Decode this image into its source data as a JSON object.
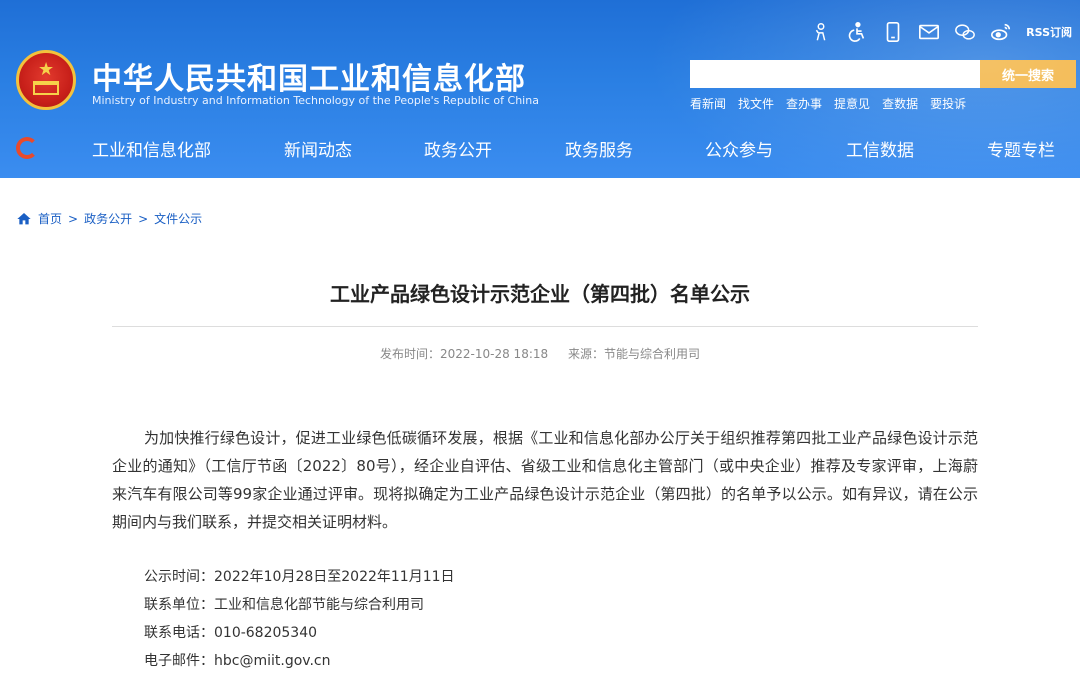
{
  "header": {
    "title": "中华人民共和国工业和信息化部",
    "subtitle": "Ministry of Industry and Information Technology of the People's Republic of China",
    "rss_label": "RSS订阅",
    "search_placeholder": "",
    "search_button": "统一搜索",
    "quick_links": [
      "看新闻",
      "找文件",
      "查办事",
      "提意见",
      "查数据",
      "要投诉"
    ],
    "nav": [
      "工业和信息化部",
      "新闻动态",
      "政务公开",
      "政务服务",
      "公众参与",
      "工信数据",
      "专题专栏"
    ]
  },
  "breadcrumb": [
    "首页",
    "政务公开",
    "文件公示"
  ],
  "article": {
    "title": "工业产品绿色设计示范企业（第四批）名单公示",
    "publish_time": "发布时间：2022-10-28 18:18",
    "source": "来源：节能与综合利用司",
    "paragraph": "为加快推行绿色设计，促进工业绿色低碳循环发展，根据《工业和信息化部办公厅关于组织推荐第四批工业产品绿色设计示范企业的通知》（工信厅节函〔2022〕80号），经企业自评估、省级工业和信息化主管部门（或中央企业）推荐及专家评审，上海蔚来汽车有限公司等99家企业通过评审。现将拟确定为工业产品绿色设计示范企业（第四批）的名单予以公示。如有异议，请在公示期间内与我们联系，并提交相关证明材料。",
    "contact": [
      "公示时间：2022年10月28日至2022年11月11日",
      "联系单位：工业和信息化部节能与综合利用司",
      "联系电话：010-68205340",
      "电子邮件：hbc@miit.gov.cn"
    ]
  },
  "icons": [
    "elder-mode-icon",
    "accessibility-icon",
    "mobile-icon",
    "mail-icon",
    "wechat-icon",
    "weibo-icon",
    "home-icon"
  ]
}
